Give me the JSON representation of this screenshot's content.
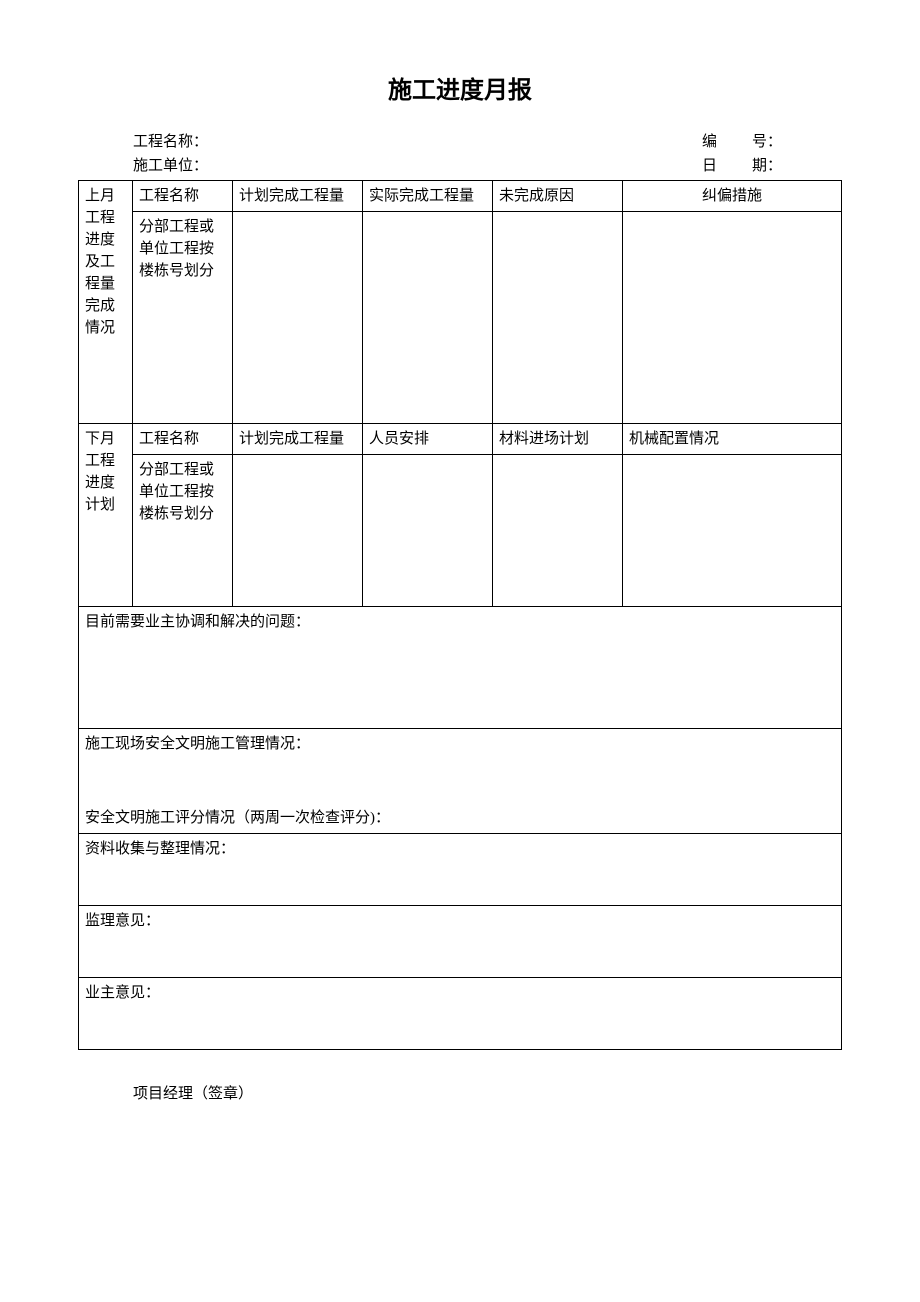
{
  "title": "施工进度月报",
  "header": {
    "projectLabel": "工程名称：",
    "projectValue": "",
    "contractorLabel": "施工单位：",
    "contractorValue": "",
    "numberLabel": "编",
    "numberSuffix": "号：",
    "numberValue": "",
    "dateLabel": "日",
    "dateSuffix": "期：",
    "dateValue": ""
  },
  "section1": {
    "sideLabel": "上月工程进度及工程量完成情况",
    "row1": {
      "c1": "工程名称",
      "c2": "计划完成工程量",
      "c3": "实际完成工程量",
      "c4": "未完成原因",
      "c5": "纠偏措施"
    },
    "row2": {
      "c1": "分部工程或单位工程按楼栋号划分",
      "c2": "",
      "c3": "",
      "c4": "",
      "c5": ""
    }
  },
  "section2": {
    "sideLabel": "下月工程进度计划",
    "row1": {
      "c1": "工程名称",
      "c2": "计划完成工程量",
      "c3": "人员安排",
      "c4": "材料进场计划",
      "c5": "机械配置情况"
    },
    "row2": {
      "c1": "分部工程或单位工程按楼栋号划分",
      "c2": "",
      "c3": "",
      "c4": "",
      "c5": ""
    }
  },
  "ownerIssue": "目前需要业主协调和解决的问题：",
  "safetyMgmt": {
    "line1": "施工现场安全文明施工管理情况：",
    "line2": "安全文明施工评分情况（两周一次检查评分)："
  },
  "dataCollect": "资料收集与整理情况：",
  "supervisorOpinion": "监理意见：",
  "ownerOpinion": "业主意见：",
  "signLine": "项目经理（签章）"
}
